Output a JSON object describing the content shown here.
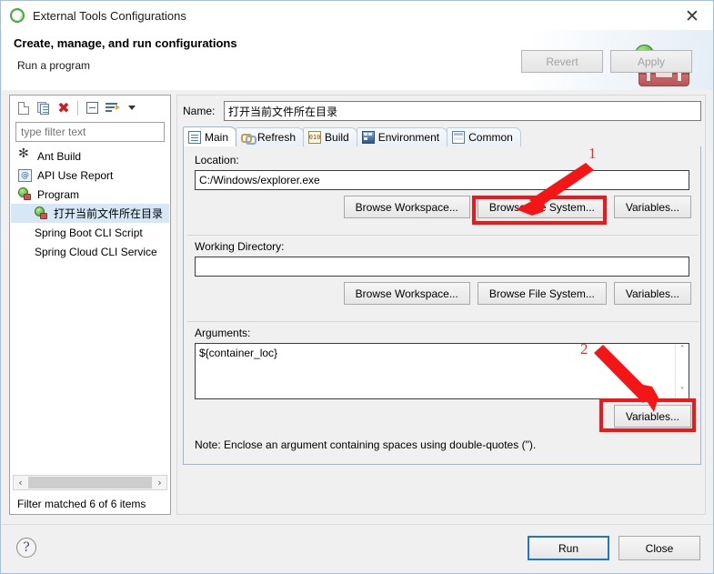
{
  "window": {
    "title": "External Tools Configurations",
    "icon": "eclipse-icon",
    "close_label": "✕"
  },
  "header": {
    "title": "Create, manage, and run configurations",
    "subtitle": "Run a program",
    "graphic": "toolbox-icon"
  },
  "sidebar": {
    "toolbar": [
      {
        "name": "new-configuration",
        "icon": "new-document-icon"
      },
      {
        "name": "duplicate-configuration",
        "icon": "copy-icon"
      },
      {
        "name": "delete-configuration",
        "icon": "delete-x-icon"
      },
      {
        "name": "collapse-all",
        "icon": "collapse-all-icon"
      },
      {
        "name": "filter-configurations",
        "icon": "filter-icon"
      },
      {
        "name": "view-menu",
        "icon": "chevron-down-icon"
      }
    ],
    "filter": {
      "placeholder": "type filter text",
      "value": ""
    },
    "tree": [
      {
        "label": "Ant Build",
        "icon": "ant-icon",
        "indent": 0,
        "selected": false
      },
      {
        "label": "API Use Report",
        "icon": "api-icon",
        "indent": 0,
        "selected": false
      },
      {
        "label": "Program",
        "icon": "program-icon",
        "indent": 0,
        "selected": false
      },
      {
        "label": "打开当前文件所在目录",
        "icon": "program-icon",
        "indent": 1,
        "selected": true
      },
      {
        "label": "Spring Boot CLI Script",
        "icon": "none",
        "indent": 1,
        "selected": false
      },
      {
        "label": "Spring Cloud CLI Service",
        "icon": "none",
        "indent": 1,
        "selected": false
      }
    ],
    "scroll_left": "‹",
    "scroll_right": "›",
    "status": "Filter matched 6 of 6 items"
  },
  "main": {
    "name_label": "Name:",
    "name_value": "打开当前文件所在目录",
    "tabs": [
      {
        "label": "Main",
        "icon": "main-tab-icon",
        "active": true
      },
      {
        "label": "Refresh",
        "icon": "refresh-tab-icon",
        "active": false
      },
      {
        "label": "Build",
        "icon": "build-tab-icon",
        "active": false
      },
      {
        "label": "Environment",
        "icon": "environment-tab-icon",
        "active": false
      },
      {
        "label": "Common",
        "icon": "common-tab-icon",
        "active": false
      }
    ],
    "location": {
      "label": "Location:",
      "value": "C:/Windows/explorer.exe",
      "buttons": {
        "browse_workspace": "Browse Workspace...",
        "browse_file_system": "Browse File System...",
        "variables": "Variables..."
      }
    },
    "working_directory": {
      "label": "Working Directory:",
      "value": "",
      "buttons": {
        "browse_workspace": "Browse Workspace...",
        "browse_file_system": "Browse File System...",
        "variables": "Variables..."
      }
    },
    "arguments": {
      "label": "Arguments:",
      "value": "${container_loc}",
      "scroll_up": "˄",
      "scroll_down": "˅",
      "variables_button": "Variables...",
      "note": "Note: Enclose an argument containing spaces using double-quotes (\")."
    },
    "revert_label": "Revert",
    "apply_label": "Apply"
  },
  "footer": {
    "help": "?",
    "run_label": "Run",
    "close_label": "Close"
  },
  "annotations": {
    "highlight_color": "#f41616",
    "markers": [
      {
        "number": "1",
        "target": "browse-file-system-location-button"
      },
      {
        "number": "2",
        "target": "variables-arguments-button"
      }
    ]
  }
}
